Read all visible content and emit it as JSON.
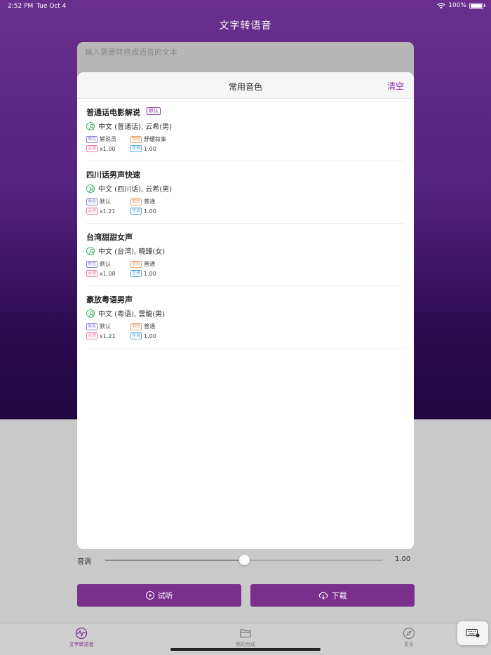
{
  "status_bar": {
    "time": "2:52 PM",
    "date": "Tue Oct 4",
    "battery": "100%"
  },
  "app": {
    "title": "文字转语音",
    "input_placeholder": "输入需要转换成语音的文本"
  },
  "sheet": {
    "title": "常用音色",
    "clear_label": "清空",
    "voices": [
      {
        "name": "普通话电影解说",
        "badge": "默认",
        "language": "中文 (普通话), 云希(男)",
        "role_tag": "角色",
        "role": "解说员",
        "mood_tag": "情感",
        "mood": "舒缓叙事",
        "speed_tag": "语速",
        "speed": "x1.00",
        "pitch_tag": "音调",
        "pitch": "1.00"
      },
      {
        "name": "四川话男声快速",
        "language": "中文 (四川话), 云希(男)",
        "role_tag": "角色",
        "role": "默认",
        "mood_tag": "情感",
        "mood": "普通",
        "speed_tag": "语速",
        "speed": "x1.21",
        "pitch_tag": "音调",
        "pitch": "1.00"
      },
      {
        "name": "台湾甜甜女声",
        "language": "中文 (台湾), 曉臻(女)",
        "role_tag": "角色",
        "role": "默认",
        "mood_tag": "情感",
        "mood": "普通",
        "speed_tag": "语速",
        "speed": "x1.08",
        "pitch_tag": "音调",
        "pitch": "1.00"
      },
      {
        "name": "豪放粤语男声",
        "language": "中文 (粤语), 雲龍(男)",
        "role_tag": "角色",
        "role": "默认",
        "mood_tag": "情感",
        "mood": "普通",
        "speed_tag": "语速",
        "speed": "x1.21",
        "pitch_tag": "音调",
        "pitch": "1.00"
      }
    ]
  },
  "pitch_control": {
    "label": "音调",
    "value": "1.00",
    "level": 0.5
  },
  "buttons": {
    "listen": "试听",
    "download": "下载"
  },
  "tabs": [
    {
      "label": "文字转语音",
      "icon": "waveform-icon",
      "active": true
    },
    {
      "label": "我的合成",
      "icon": "folder-icon",
      "active": false
    },
    {
      "label": "更多",
      "icon": "compass-icon",
      "active": false
    }
  ],
  "colors": {
    "accent": "#7a2f8d",
    "green": "#4ab36a"
  }
}
